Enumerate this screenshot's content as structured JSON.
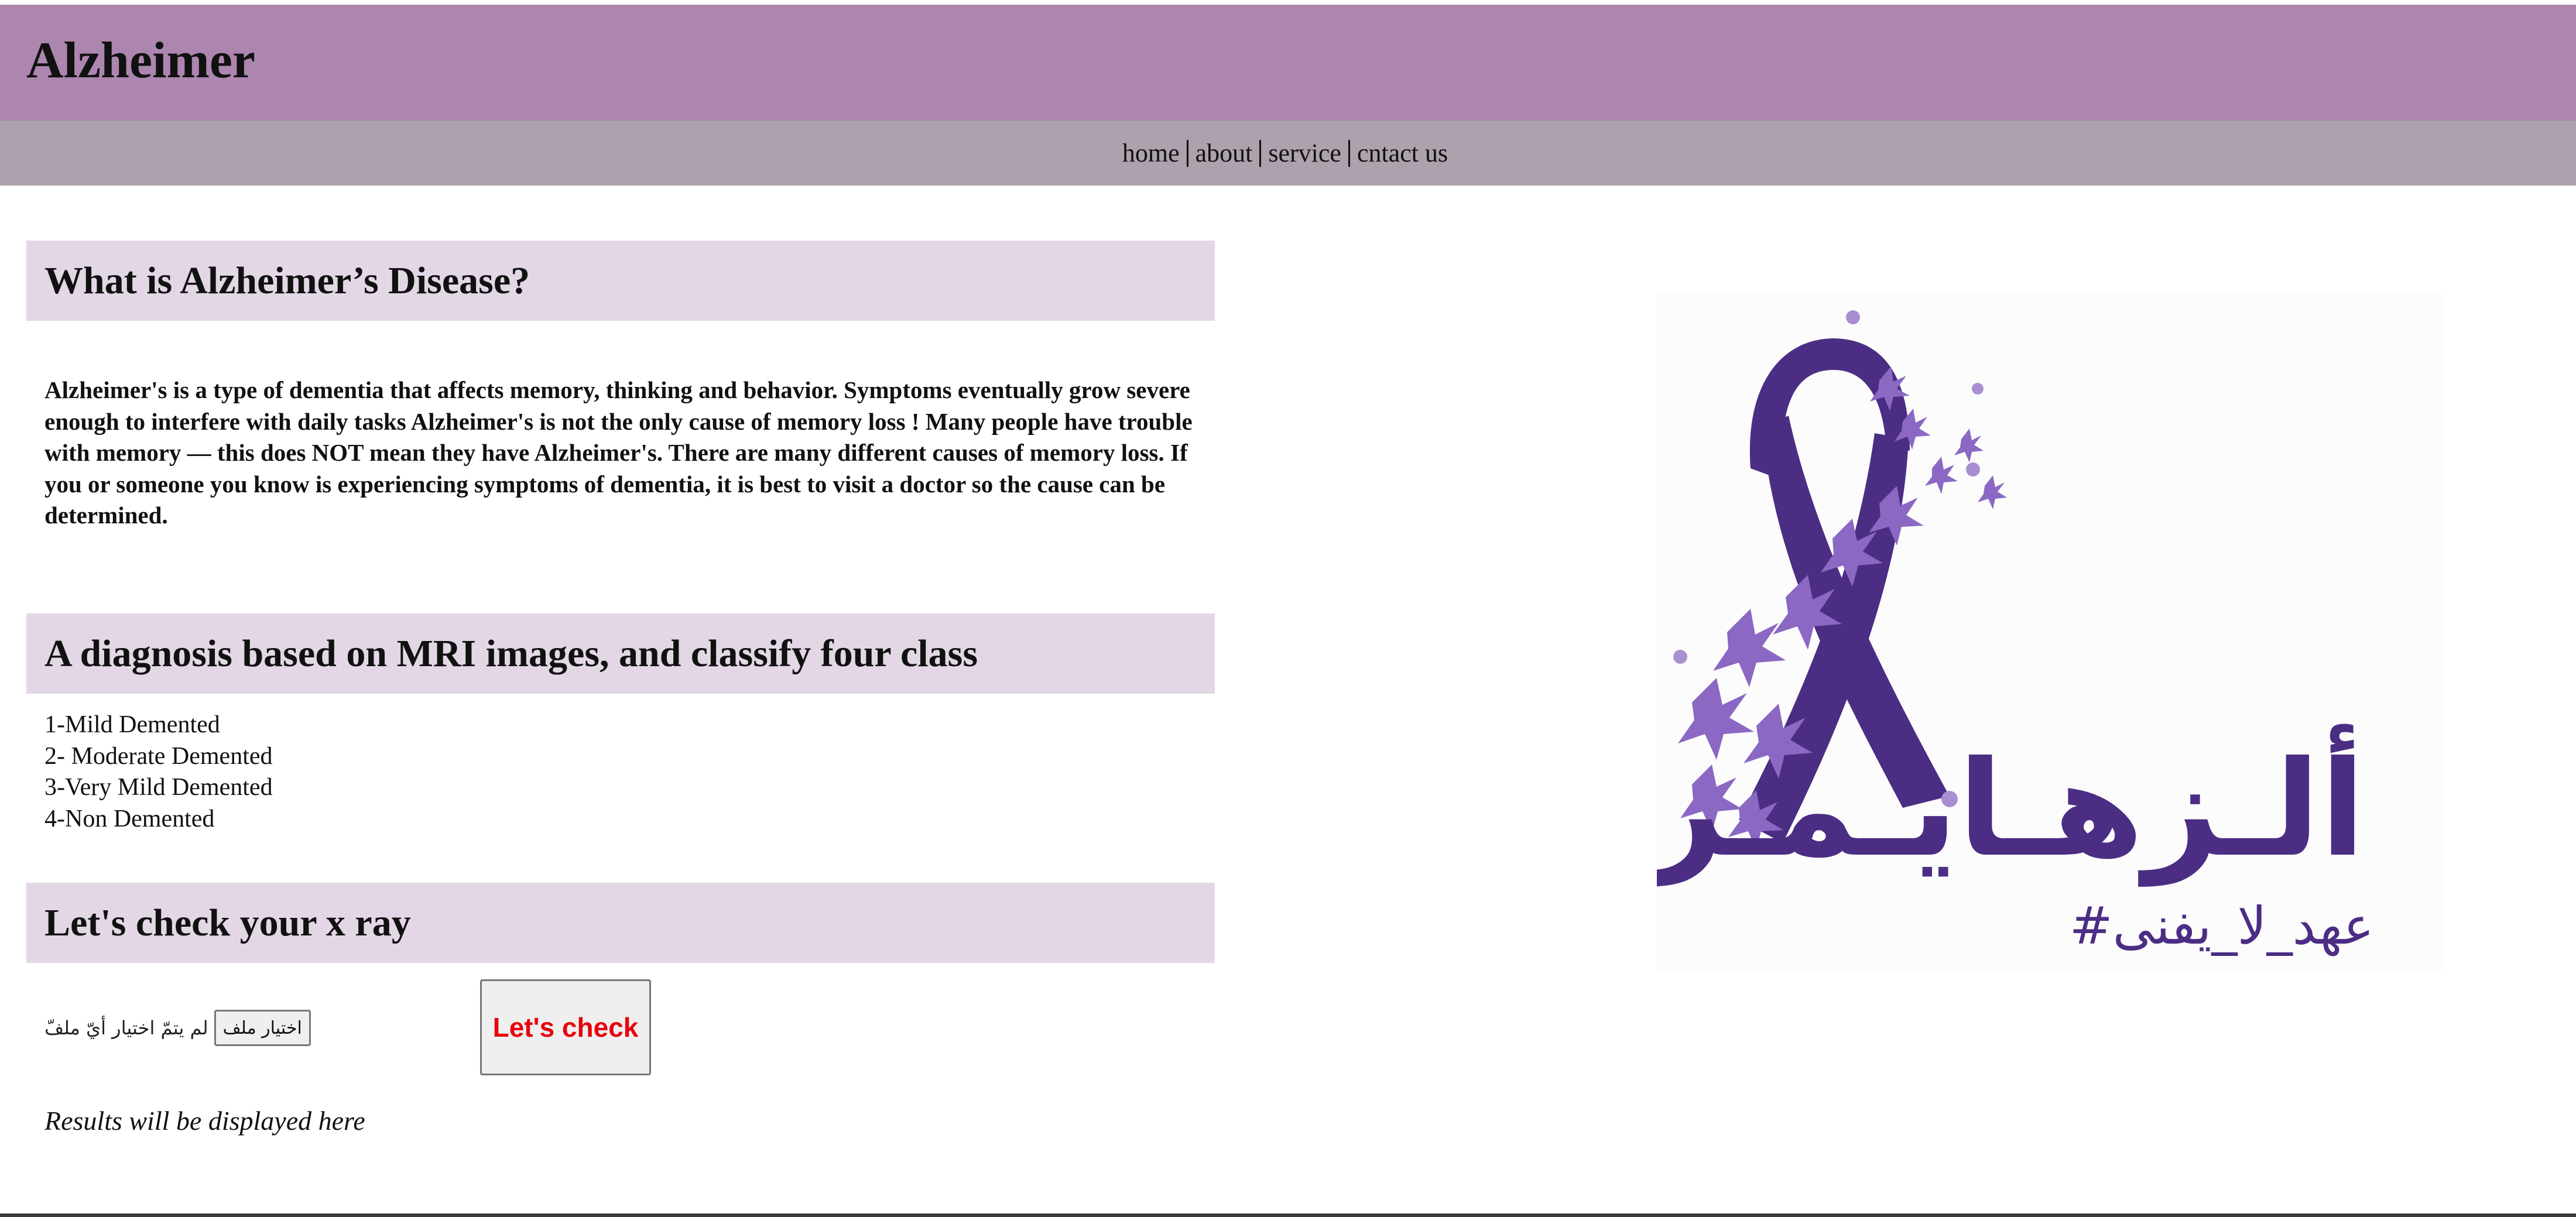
{
  "header": {
    "title": "Alzheimer"
  },
  "nav": {
    "items": [
      "home",
      "about",
      "service",
      "cntact us"
    ]
  },
  "sections": {
    "what_is": {
      "heading": "What is Alzheimer’s Disease?",
      "body": "Alzheimer's is a type of dementia that affects memory, thinking and behavior. Symptoms eventually grow severe enough to interfere with daily tasks Alzheimer's is not the only cause of memory loss ! Many people have trouble with memory — this does NOT mean they have Alzheimer's. There are many different causes of memory loss. If you or someone you know is experiencing symptoms of dementia, it is best to visit a doctor so the cause can be determined."
    },
    "diagnosis": {
      "heading": "A diagnosis based on MRI images, and classify four class",
      "classes": [
        "1-Mild Demented",
        "2- Moderate Demented",
        "3-Very Mild Demented",
        "4-Non Demented"
      ]
    },
    "check": {
      "heading": "Let's check your x ray",
      "file_button_label": "اختيار ملف",
      "file_status": "لم يتمّ اختيار أيّ ملفّ",
      "check_button_label": "Let's check",
      "results_text": "Results will be displayed here"
    }
  },
  "logo": {
    "arabic_title": "ألـزهـايـمـر",
    "hashtag": "#عهد_لا_يفنى",
    "colors": {
      "dark_purple": "#4c2d84",
      "light_purple": "#8b68c3",
      "pale_purple": "#a98fd1"
    }
  },
  "colors": {
    "header_bg": "#ac86ae",
    "nav_bg": "#aca1ad",
    "section_heading_bg": "#e3d7e6",
    "check_button_text": "#e8000b"
  }
}
